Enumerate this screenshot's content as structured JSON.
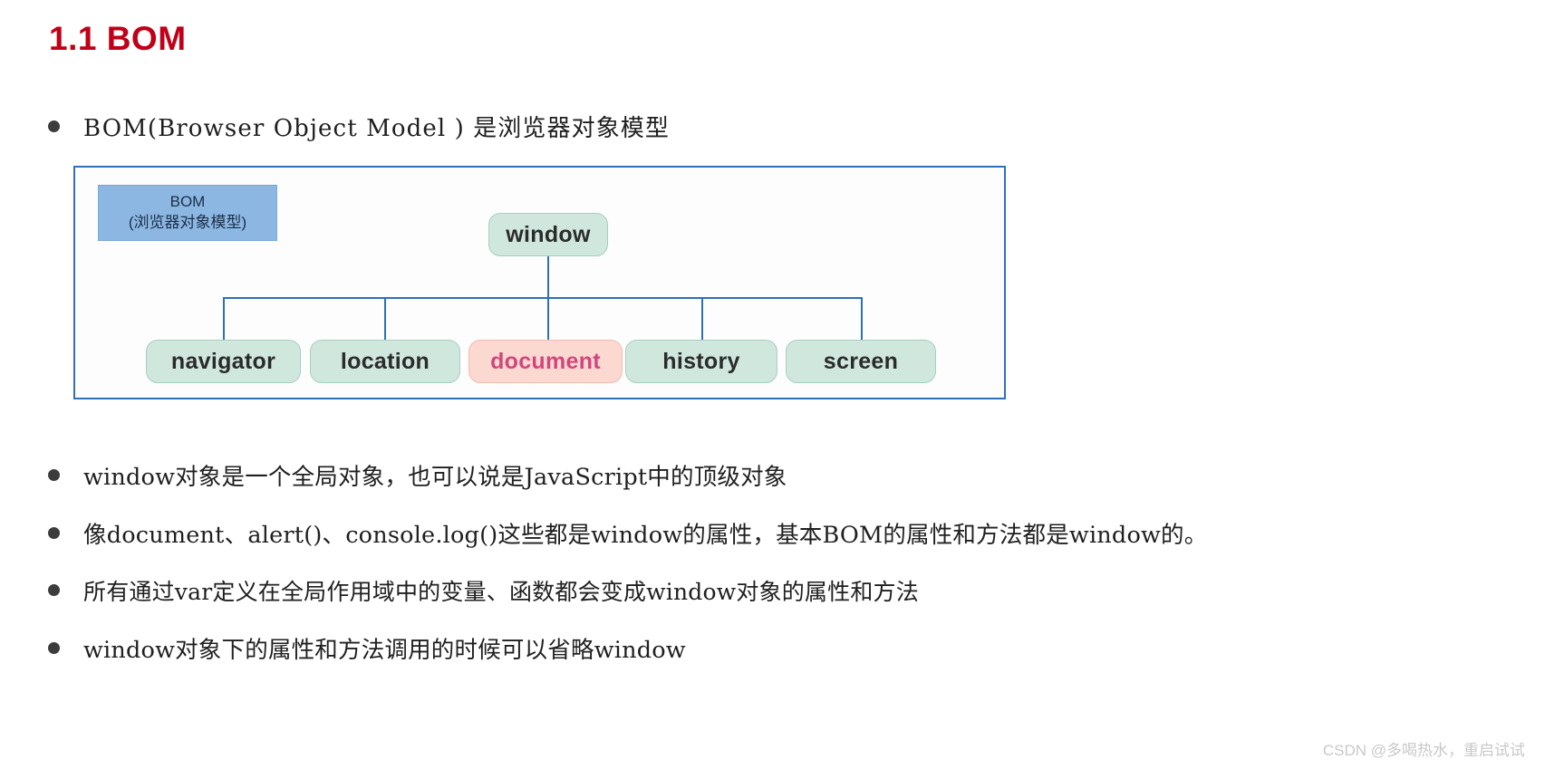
{
  "page": {
    "title": "1.1 BOM",
    "title_color": "#c00018",
    "background": "#ffffff"
  },
  "bullets": [
    {
      "id": "bom-definition",
      "text": "BOM(Browser Object Model ) 是浏览器对象模型"
    },
    {
      "id": "window-global",
      "text": "window对象是一个全局对象，也可以说是JavaScript中的顶级对象"
    },
    {
      "id": "window-members",
      "text": "像document、alert()、console.log()这些都是window的属性，基本BOM的属性和方法都是window的。"
    },
    {
      "id": "var-global-scope",
      "text": "所有通过var定义在全局作用域中的变量、函数都会变成window对象的属性和方法"
    },
    {
      "id": "window-omittable",
      "text": "window对象下的属性和方法调用的时候可以省略window"
    }
  ],
  "diagram": {
    "border_color": "#2f6fb8",
    "legend": {
      "line1": "BOM",
      "line2": "(浏览器对象模型)",
      "fill": "#8cb7e2"
    },
    "root": {
      "label": "window",
      "fill": "#cfe7dd",
      "text_color": "#2b2b2b"
    },
    "children": [
      {
        "label": "navigator",
        "fill": "#cfe7dd",
        "text_color": "#2b2b2b"
      },
      {
        "label": "location",
        "fill": "#cfe7dd",
        "text_color": "#2b2b2b"
      },
      {
        "label": "document",
        "fill": "#fbd8d0",
        "text_color": "#d0477e"
      },
      {
        "label": "history",
        "fill": "#cfe7dd",
        "text_color": "#2b2b2b"
      },
      {
        "label": "screen",
        "fill": "#cfe7dd",
        "text_color": "#2b2b2b"
      }
    ]
  },
  "watermark": {
    "text": "CSDN @多喝热水，重启试试"
  }
}
